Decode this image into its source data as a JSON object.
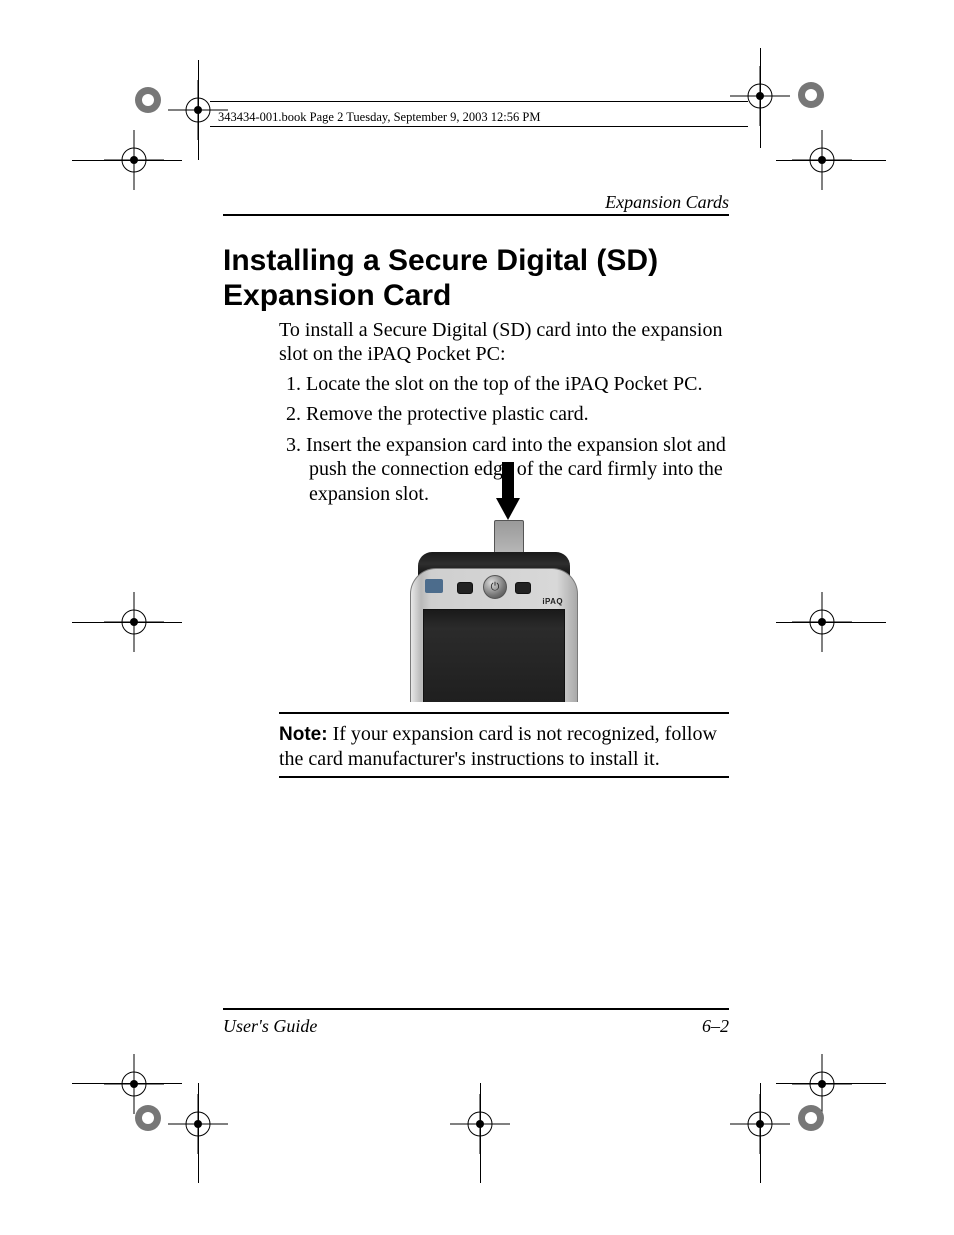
{
  "print_header": "343434-001.book  Page 2  Tuesday, September 9, 2003  12:56 PM",
  "running_head": "Expansion Cards",
  "heading": "Installing a Secure Digital (SD) Expansion Card",
  "intro": "To install a Secure Digital (SD) card into the expansion slot on the iPAQ Pocket PC:",
  "steps": [
    "Locate the slot on the top of the iPAQ Pocket PC.",
    "Remove the protective plastic card.",
    "Insert the expansion card into the expansion slot and push the connection edge of the card firmly into the expansion slot."
  ],
  "note_label": "Note:",
  "note_body": " If your expansion card is not recognized, follow the card manufacturer's instructions to install it.",
  "footer_left": "User's Guide",
  "footer_right": "6–2",
  "device_brand": "iPAQ",
  "power_glyph": "⏻"
}
